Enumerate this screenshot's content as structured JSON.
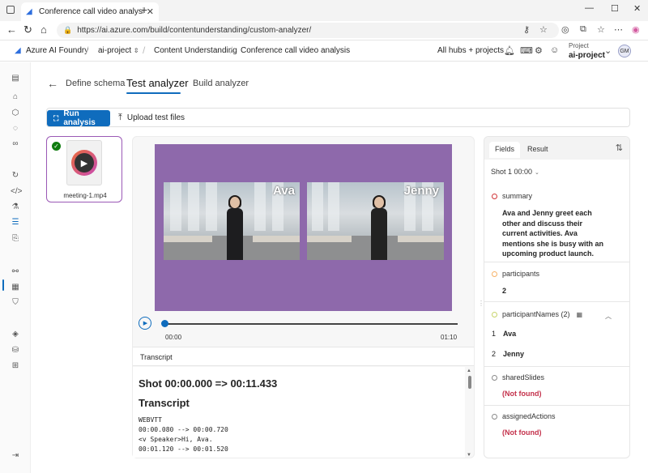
{
  "browser": {
    "tab_title": "Conference call video analysis - A",
    "tab_close": "✕",
    "new_tab": "+",
    "url": "https://ai.azure.com/build/contentunderstanding/custom-analyzer/",
    "win_min": "—",
    "win_max": "☐",
    "win_close": "✕"
  },
  "header": {
    "brand": "Azure AI Foundry",
    "crumbs": [
      "ai-project",
      "Content Understanding",
      "Conference call video analysis"
    ],
    "hubs_link": "All hubs + projects",
    "project_label": "Project",
    "project_name": "ai-project",
    "avatar_initials": "GM"
  },
  "page": {
    "tabs": [
      "Define schema",
      "Test analyzer",
      "Build analyzer"
    ],
    "active_tab": "Test analyzer",
    "run_button": "Run analysis",
    "upload_button": "Upload test files"
  },
  "file": {
    "name": "meeting-1.mp4",
    "status": "✓"
  },
  "video": {
    "speakers": [
      "Ava",
      "Jenny"
    ],
    "background_color": "#8e69ab",
    "current_time": "00:00",
    "duration": "01:10",
    "progress_fraction": 0.0
  },
  "transcript": {
    "label": "Transcript",
    "shot_heading": "Shot 00:00.000 => 00:11.433",
    "section_heading": "Transcript",
    "lines": [
      "WEBVTT",
      "",
      "00:00.080 --> 00:00.720",
      "<v Speaker>Hi, Ava.",
      "00:01.120 --> 00:01.520"
    ]
  },
  "results": {
    "tabs": [
      "Fields",
      "Result"
    ],
    "active_tab": "Fields",
    "shot_selector": "Shot 1 00:00",
    "fields": [
      {
        "name": "summary",
        "dot_color": "#d13438",
        "value": "Ava and Jenny greet each other and discuss their current activities. Ava mentions she is busy with an upcoming product launch."
      },
      {
        "name": "participants",
        "dot_color": "#f7b267",
        "value": "2"
      },
      {
        "name": "participantNames (2)",
        "dot_color": "#c8d46b",
        "items": [
          {
            "index": "1",
            "value": "Ava"
          },
          {
            "index": "2",
            "value": "Jenny"
          }
        ]
      },
      {
        "name": "sharedSlides",
        "dot_color": "#8a8a8a",
        "value": "(Not found)"
      },
      {
        "name": "assignedActions",
        "dot_color": "#8a8a8a",
        "value": "(Not found)"
      }
    ]
  },
  "colors": {
    "accent": "#0f6cbd",
    "not_found": "#c4314b",
    "file_border": "#9b59b6"
  }
}
